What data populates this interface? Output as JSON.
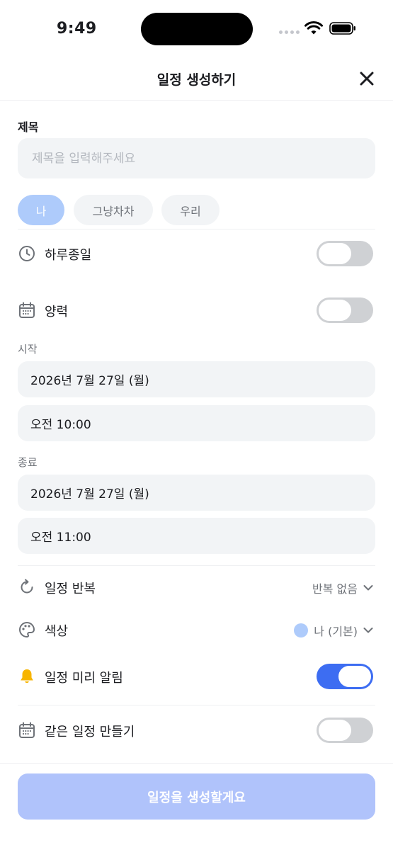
{
  "status_bar": {
    "time": "9:49"
  },
  "header": {
    "title": "일정 생성하기"
  },
  "title_section": {
    "label": "제목",
    "placeholder": "제목을 입력해주세요",
    "value": ""
  },
  "calendar_chips": [
    {
      "label": "나",
      "active": true
    },
    {
      "label": "그냥차차",
      "active": false
    },
    {
      "label": "우리",
      "active": false
    }
  ],
  "all_day": {
    "label": "하루종일",
    "on": false
  },
  "solar": {
    "label": "양력",
    "on": false
  },
  "start": {
    "label": "시작",
    "date": "2026년 7월 27일 (월)",
    "time": "오전 10:00"
  },
  "end": {
    "label": "종료",
    "date": "2026년 7월 27일 (월)",
    "time": "오전 11:00"
  },
  "repeat": {
    "label": "일정 반복",
    "value": "반복 없음"
  },
  "color": {
    "label": "색상",
    "value": "나 (기본)",
    "dot_color": "#aecbfb"
  },
  "reminder": {
    "label": "일정 미리 알림",
    "on": true
  },
  "same_event": {
    "label": "같은 일정 만들기",
    "on": false
  },
  "submit": {
    "label": "일정을 생성할게요"
  },
  "colors": {
    "accent": "#3d6df2",
    "chip_active": "#aecbfb",
    "submit_disabled": "#b0c3fb",
    "field_bg": "#f2f4f6"
  }
}
